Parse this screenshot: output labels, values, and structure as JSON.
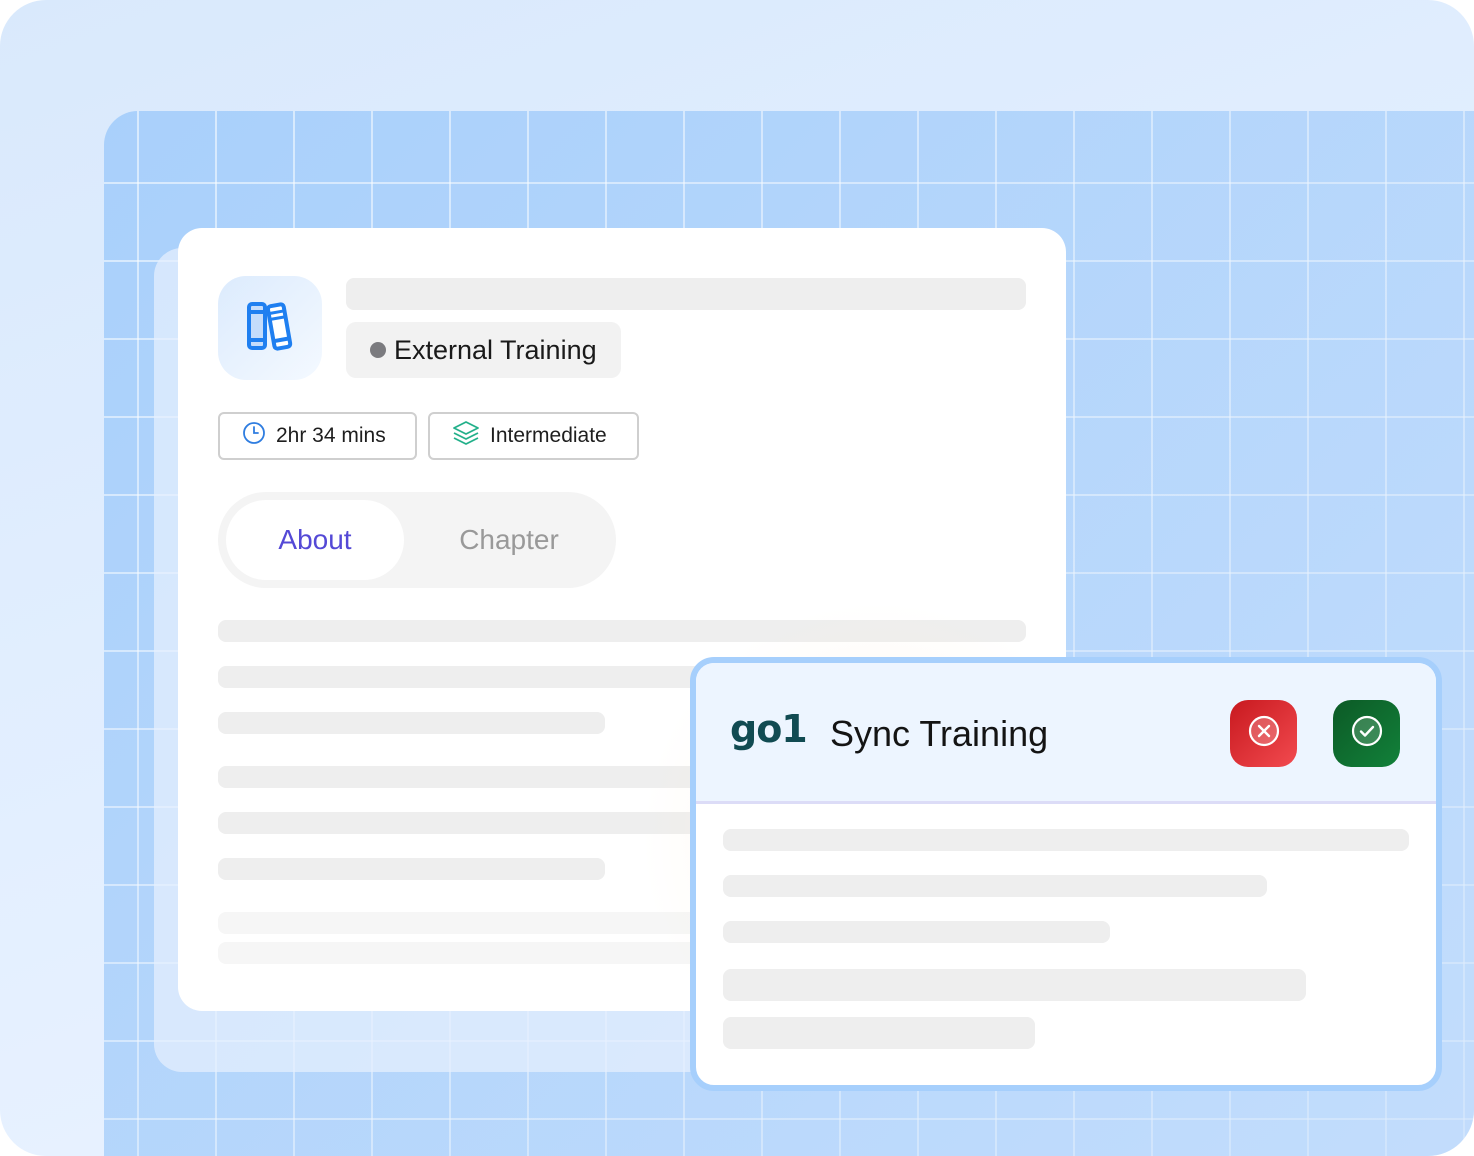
{
  "course": {
    "icon": "books-icon",
    "type_label": "External Training",
    "type_dot_color": "#7b7b7f",
    "duration": "2hr 34 mins",
    "duration_icon": "clock-icon",
    "level": "Intermediate",
    "level_icon": "layers-icon"
  },
  "tabs": [
    {
      "label": "About",
      "active": true
    },
    {
      "label": "Chapter",
      "active": false
    }
  ],
  "sync_panel": {
    "logo_text": "go1",
    "title": "Sync Training",
    "reject_icon": "x-circle-icon",
    "accept_icon": "check-circle-icon"
  },
  "colors": {
    "accent": "#5449d6",
    "reject": "#e0272d",
    "accept": "#0f6e31",
    "brand_go1": "#114b52",
    "grid_background": "#a9d0fb",
    "icon_blue": "#1f7ff0"
  }
}
